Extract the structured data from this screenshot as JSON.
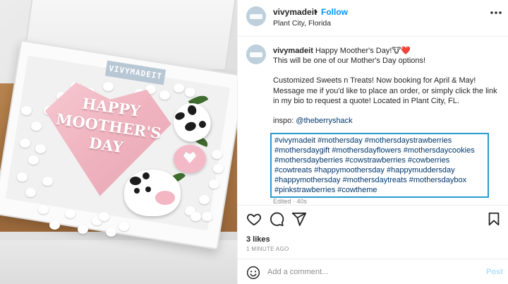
{
  "post": {
    "username": "vivymadeit",
    "follow_label": "Follow",
    "separator": "•",
    "location": "Plant City, Florida",
    "photo": {
      "tag_text": "VIVYMADEIT",
      "heart_text": "HAPPY MOOTHER'S DAY",
      "watermark": "@vivymadeit"
    },
    "caption": {
      "username": "vivymadeit",
      "line1": "Happy Moother's Day!🐮❤️",
      "line2": "This will be one of our Mother's Day options!",
      "line3": "Customized Sweets n Treats! Now booking for April & May! Message me if you'd like to place an order, or simply click the link in my bio to request a quote! Located in Plant City, FL.",
      "inspo_label": "inspo:",
      "inspo_mention": "@theberryshack",
      "hashtags": "#vivymadeit #mothersday #mothersdaystrawberries #mothersdaygift #mothersdayflowers #mothersdaycookies #mothersdayberries #cowstrawberries #cowberries #cowtreats #happymoothersday #happymuddersday #happymothersday #mothersdaytreats #mothersdaybox #pinkstrawberries #cowtheme",
      "edited": "Edited · 40s"
    },
    "likes": "3 likes",
    "timestamp": "1 MINUTE AGO",
    "comment_placeholder": "Add a comment...",
    "post_label": "Post"
  },
  "icons": {
    "more": "more-options-icon",
    "like": "heart-icon",
    "comment": "comment-icon",
    "share": "share-icon",
    "save": "bookmark-icon",
    "emoji": "emoji-icon"
  },
  "colors": {
    "link": "#0095f6",
    "hashtag": "#00376b",
    "highlight_border": "#2b9bd1",
    "avatar": "#bdd0dc"
  }
}
